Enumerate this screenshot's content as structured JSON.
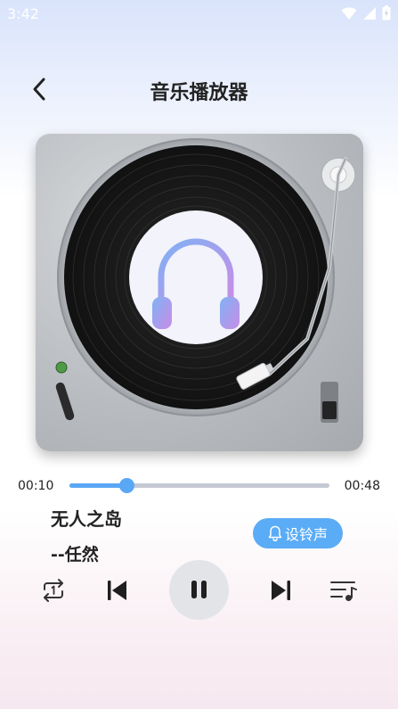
{
  "status_bar": {
    "time": "3:42"
  },
  "header": {
    "title": "音乐播放器"
  },
  "player": {
    "current_time": "00:10",
    "total_time": "00:48",
    "progress": 0.22
  },
  "song": {
    "title": "无人之岛",
    "artist": "--任然"
  },
  "ringtone_button": {
    "label": "设铃声"
  },
  "colors": {
    "accent": "#5aa7f5",
    "ringtone_bg": "#5aacf6",
    "play_bg": "#e2e4e8"
  }
}
